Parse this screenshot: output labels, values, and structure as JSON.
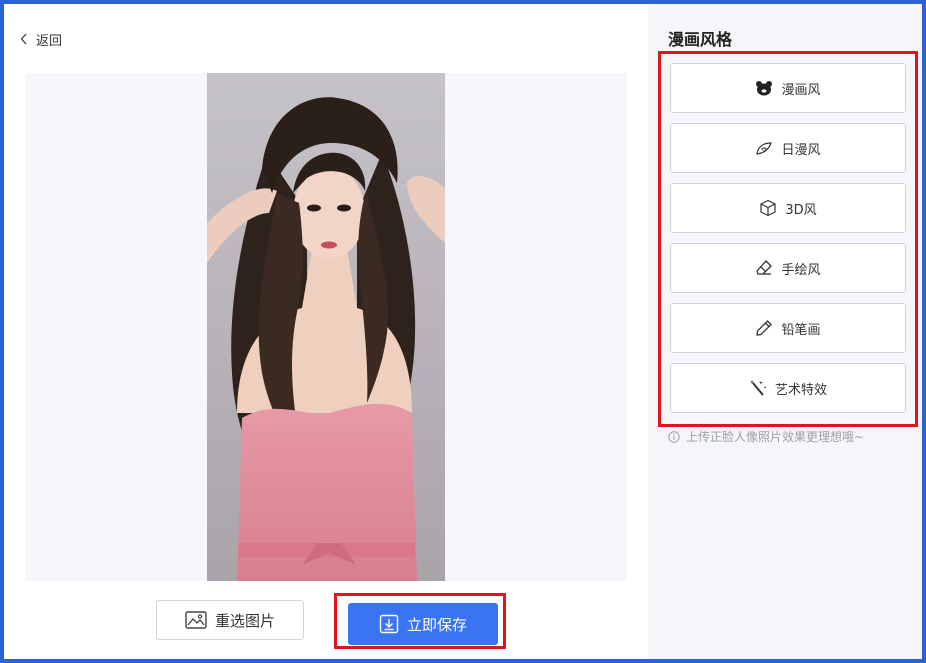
{
  "nav": {
    "back_label": "返回"
  },
  "actions": {
    "reselect_label": "重选图片",
    "save_label": "立即保存"
  },
  "sidebar": {
    "title": "漫画风格",
    "items": [
      {
        "label": "漫画风",
        "icon": "bear-icon"
      },
      {
        "label": "日漫风",
        "icon": "swirl-leaf-icon"
      },
      {
        "label": "3D风",
        "icon": "cube-icon"
      },
      {
        "label": "手绘风",
        "icon": "eraser-icon"
      },
      {
        "label": "铅笔画",
        "icon": "pencil-icon"
      },
      {
        "label": "艺术特效",
        "icon": "magic-wand-icon"
      }
    ],
    "hint": "上传正脸人像照片效果更理想哦~"
  },
  "colors": {
    "accent": "#3b74f1",
    "highlight": "#e0141e",
    "frame": "#2a63d4",
    "sidebar_bg": "#f6f6fa"
  }
}
